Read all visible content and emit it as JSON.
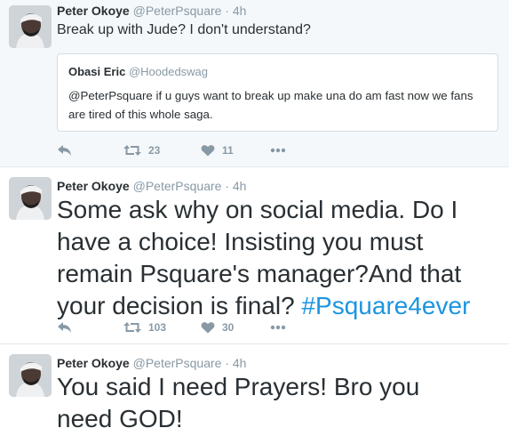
{
  "tweets": [
    {
      "author_name": "Peter Okoye",
      "handle": "@PeterPsquare",
      "separator": "·",
      "time": "4h",
      "text": "Break up with Jude? I don't understand?",
      "quote": {
        "author_name": "Obasi Eric",
        "handle": "@Hoodedswag",
        "text": "@PeterPsquare if u guys want to break up make una do am fast now we fans are tired of this whole saga."
      },
      "retweets": "23",
      "likes": "11"
    },
    {
      "author_name": "Peter Okoye",
      "handle": "@PeterPsquare",
      "separator": "·",
      "time": "4h",
      "text_main": "Some ask why on social media. Do I have a choice! Insisting you must remain Psquare's manager?And that your decision is final?",
      "hashtag": "#Psquare4ever",
      "retweets": "103",
      "likes": "30"
    },
    {
      "author_name": "Peter Okoye",
      "handle": "@PeterPsquare",
      "separator": "·",
      "time": "4h",
      "text": "You said I need Prayers! Bro you need GOD!"
    }
  ],
  "colors": {
    "text": "#292f33",
    "muted": "#8899a6",
    "link": "#1b95e0",
    "highlight_bg": "#f5f8fa",
    "border": "#e1e8ed"
  },
  "icons": [
    "reply-icon",
    "retweet-icon",
    "heart-icon",
    "more-icon"
  ]
}
